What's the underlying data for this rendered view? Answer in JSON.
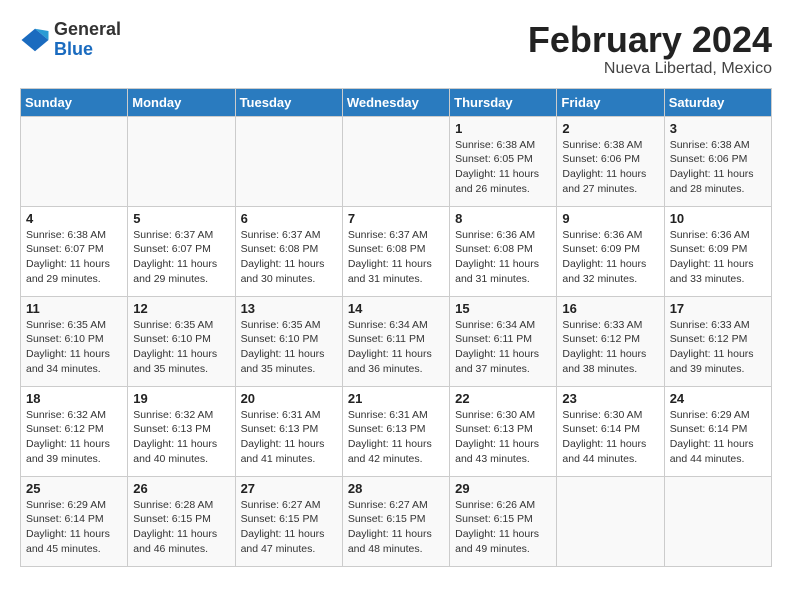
{
  "header": {
    "logo_general": "General",
    "logo_blue": "Blue",
    "month_year": "February 2024",
    "location": "Nueva Libertad, Mexico"
  },
  "days_of_week": [
    "Sunday",
    "Monday",
    "Tuesday",
    "Wednesday",
    "Thursday",
    "Friday",
    "Saturday"
  ],
  "weeks": [
    [
      {
        "day": "",
        "info": ""
      },
      {
        "day": "",
        "info": ""
      },
      {
        "day": "",
        "info": ""
      },
      {
        "day": "",
        "info": ""
      },
      {
        "day": "1",
        "info": "Sunrise: 6:38 AM\nSunset: 6:05 PM\nDaylight: 11 hours and 26 minutes."
      },
      {
        "day": "2",
        "info": "Sunrise: 6:38 AM\nSunset: 6:06 PM\nDaylight: 11 hours and 27 minutes."
      },
      {
        "day": "3",
        "info": "Sunrise: 6:38 AM\nSunset: 6:06 PM\nDaylight: 11 hours and 28 minutes."
      }
    ],
    [
      {
        "day": "4",
        "info": "Sunrise: 6:38 AM\nSunset: 6:07 PM\nDaylight: 11 hours and 29 minutes."
      },
      {
        "day": "5",
        "info": "Sunrise: 6:37 AM\nSunset: 6:07 PM\nDaylight: 11 hours and 29 minutes."
      },
      {
        "day": "6",
        "info": "Sunrise: 6:37 AM\nSunset: 6:08 PM\nDaylight: 11 hours and 30 minutes."
      },
      {
        "day": "7",
        "info": "Sunrise: 6:37 AM\nSunset: 6:08 PM\nDaylight: 11 hours and 31 minutes."
      },
      {
        "day": "8",
        "info": "Sunrise: 6:36 AM\nSunset: 6:08 PM\nDaylight: 11 hours and 31 minutes."
      },
      {
        "day": "9",
        "info": "Sunrise: 6:36 AM\nSunset: 6:09 PM\nDaylight: 11 hours and 32 minutes."
      },
      {
        "day": "10",
        "info": "Sunrise: 6:36 AM\nSunset: 6:09 PM\nDaylight: 11 hours and 33 minutes."
      }
    ],
    [
      {
        "day": "11",
        "info": "Sunrise: 6:35 AM\nSunset: 6:10 PM\nDaylight: 11 hours and 34 minutes."
      },
      {
        "day": "12",
        "info": "Sunrise: 6:35 AM\nSunset: 6:10 PM\nDaylight: 11 hours and 35 minutes."
      },
      {
        "day": "13",
        "info": "Sunrise: 6:35 AM\nSunset: 6:10 PM\nDaylight: 11 hours and 35 minutes."
      },
      {
        "day": "14",
        "info": "Sunrise: 6:34 AM\nSunset: 6:11 PM\nDaylight: 11 hours and 36 minutes."
      },
      {
        "day": "15",
        "info": "Sunrise: 6:34 AM\nSunset: 6:11 PM\nDaylight: 11 hours and 37 minutes."
      },
      {
        "day": "16",
        "info": "Sunrise: 6:33 AM\nSunset: 6:12 PM\nDaylight: 11 hours and 38 minutes."
      },
      {
        "day": "17",
        "info": "Sunrise: 6:33 AM\nSunset: 6:12 PM\nDaylight: 11 hours and 39 minutes."
      }
    ],
    [
      {
        "day": "18",
        "info": "Sunrise: 6:32 AM\nSunset: 6:12 PM\nDaylight: 11 hours and 39 minutes."
      },
      {
        "day": "19",
        "info": "Sunrise: 6:32 AM\nSunset: 6:13 PM\nDaylight: 11 hours and 40 minutes."
      },
      {
        "day": "20",
        "info": "Sunrise: 6:31 AM\nSunset: 6:13 PM\nDaylight: 11 hours and 41 minutes."
      },
      {
        "day": "21",
        "info": "Sunrise: 6:31 AM\nSunset: 6:13 PM\nDaylight: 11 hours and 42 minutes."
      },
      {
        "day": "22",
        "info": "Sunrise: 6:30 AM\nSunset: 6:13 PM\nDaylight: 11 hours and 43 minutes."
      },
      {
        "day": "23",
        "info": "Sunrise: 6:30 AM\nSunset: 6:14 PM\nDaylight: 11 hours and 44 minutes."
      },
      {
        "day": "24",
        "info": "Sunrise: 6:29 AM\nSunset: 6:14 PM\nDaylight: 11 hours and 44 minutes."
      }
    ],
    [
      {
        "day": "25",
        "info": "Sunrise: 6:29 AM\nSunset: 6:14 PM\nDaylight: 11 hours and 45 minutes."
      },
      {
        "day": "26",
        "info": "Sunrise: 6:28 AM\nSunset: 6:15 PM\nDaylight: 11 hours and 46 minutes."
      },
      {
        "day": "27",
        "info": "Sunrise: 6:27 AM\nSunset: 6:15 PM\nDaylight: 11 hours and 47 minutes."
      },
      {
        "day": "28",
        "info": "Sunrise: 6:27 AM\nSunset: 6:15 PM\nDaylight: 11 hours and 48 minutes."
      },
      {
        "day": "29",
        "info": "Sunrise: 6:26 AM\nSunset: 6:15 PM\nDaylight: 11 hours and 49 minutes."
      },
      {
        "day": "",
        "info": ""
      },
      {
        "day": "",
        "info": ""
      }
    ]
  ]
}
